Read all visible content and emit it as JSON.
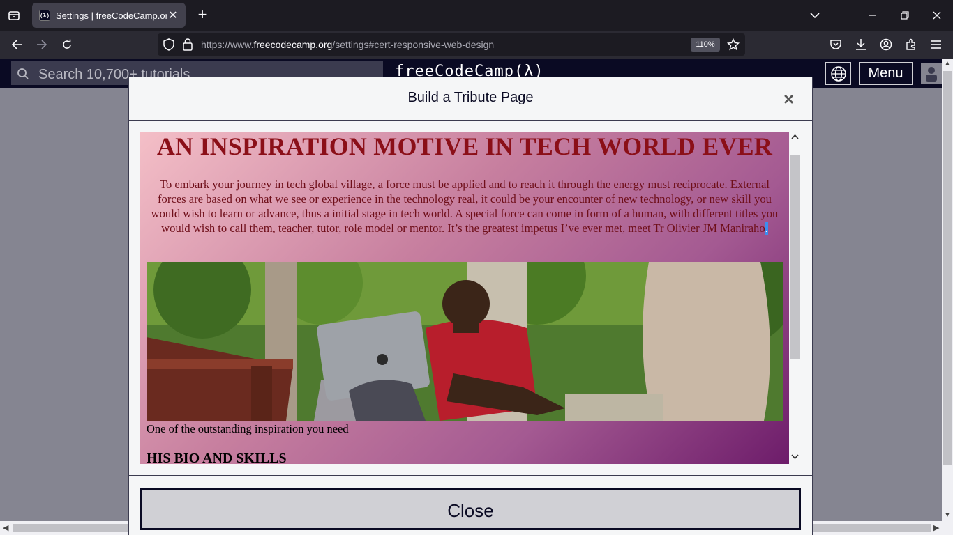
{
  "browser": {
    "tab_title": "Settings | freeCodeCamp.org",
    "tab_favicon_text": "(λ)",
    "url_scheme": "https://www.",
    "url_host": "freecodecamp.org",
    "url_path": "/settings#cert-responsive-web-design",
    "zoom": "110%"
  },
  "fcc_header": {
    "search_placeholder": "Search 10,700+ tutorials",
    "logo": "freeCodeCamp(λ)",
    "menu_label": "Menu"
  },
  "modal": {
    "title": "Build a Tribute Page",
    "close_x": "×",
    "close_button": "Close"
  },
  "tribute": {
    "heading": "AN INSPIRATION MOTIVE IN TECH WORLD EVER",
    "intro": "To embark your journey in tech global village, a force must be applied and to reach it through the energy must reciprocate. External forces are based on what we see or experience in the technology real, it could be your encounter of new technology, or new skill you would wish to learn or advance, thus a initial stage in tech world. A special force can come in form of a human, with different titles you would wish to call them, teacher, tutor, role model or mentor. It’s the greatest impetus I’ve ever met, meet Tr Olivier JM Maniraho",
    "intro_selected": ".",
    "caption": "One of the outstanding inspiration you need",
    "subheading": "HIS BIO AND SKILLS"
  },
  "colors": {
    "fcc_dark": "#0a0a23",
    "heading_red": "#8b0f18",
    "gradient_start": "#f4bfc7",
    "gradient_end": "#6d1c6a"
  }
}
